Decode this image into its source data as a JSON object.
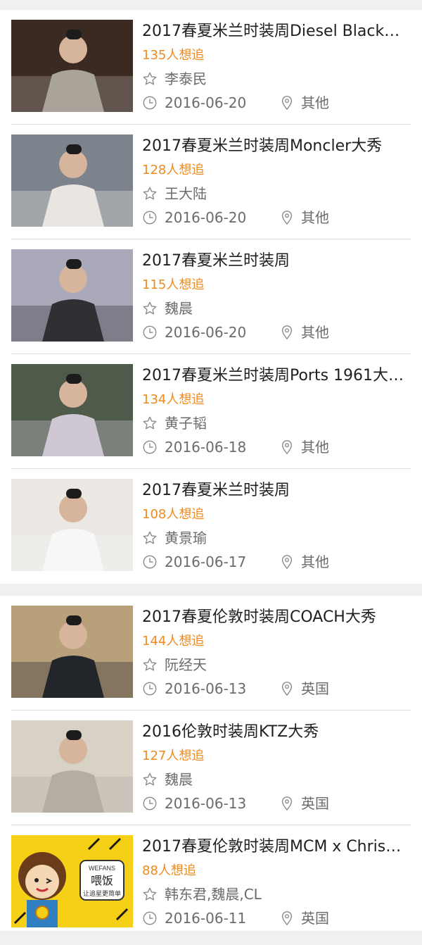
{
  "sections": [
    {
      "items": [
        {
          "title": "2017春夏米兰时装周Diesel Black…",
          "followers": "135人想追",
          "stars": "李泰民",
          "date": "2016-06-20",
          "location": "其他",
          "thumb": {
            "bg": "#3a2a22",
            "accent": "#a9a39a"
          }
        },
        {
          "title": "2017春夏米兰时装周Moncler大秀",
          "followers": "128人想追",
          "stars": "王大陆",
          "date": "2016-06-20",
          "location": "其他",
          "thumb": {
            "bg": "#7d838c",
            "accent": "#e9e6e1"
          }
        },
        {
          "title": "2017春夏米兰时装周",
          "followers": "115人想追",
          "stars": "魏晨",
          "date": "2016-06-20",
          "location": "其他",
          "thumb": {
            "bg": "#a9a9b9",
            "accent": "#2f2f34"
          }
        },
        {
          "title": "2017春夏米兰时装周Ports 1961大…",
          "followers": "134人想追",
          "stars": "黄子韬",
          "date": "2016-06-18",
          "location": "其他",
          "thumb": {
            "bg": "#4f5b4a",
            "accent": "#cfc7d4"
          }
        },
        {
          "title": "2017春夏米兰时装周",
          "followers": "108人想追",
          "stars": "黄景瑜",
          "date": "2016-06-17",
          "location": "其他",
          "thumb": {
            "bg": "#ebe8e4",
            "accent": "#f7f7f7"
          }
        }
      ]
    },
    {
      "items": [
        {
          "title": "2017春夏伦敦时装周COACH大秀",
          "followers": "144人想追",
          "stars": "阮经天",
          "date": "2016-06-13",
          "location": "英国",
          "thumb": {
            "bg": "#b8a07a",
            "accent": "#22252a"
          }
        },
        {
          "title": "2016伦敦时装周KTZ大秀",
          "followers": "127人想追",
          "stars": "魏晨",
          "date": "2016-06-13",
          "location": "英国",
          "thumb": {
            "bg": "#d8d2c6",
            "accent": "#b3ada3"
          }
        },
        {
          "title": "2017春夏伦敦时装周MCM x Chris…",
          "followers": "88人想追",
          "stars": "韩东君,魏晨,CL",
          "date": "2016-06-11",
          "location": "英国",
          "thumb": {
            "bg": "#f6cf17",
            "accent": "#2a2a2a",
            "logo_line1": "WEFANS",
            "logo_line2": "喂饭",
            "logo_line3": "让追星更简单"
          }
        }
      ]
    }
  ]
}
